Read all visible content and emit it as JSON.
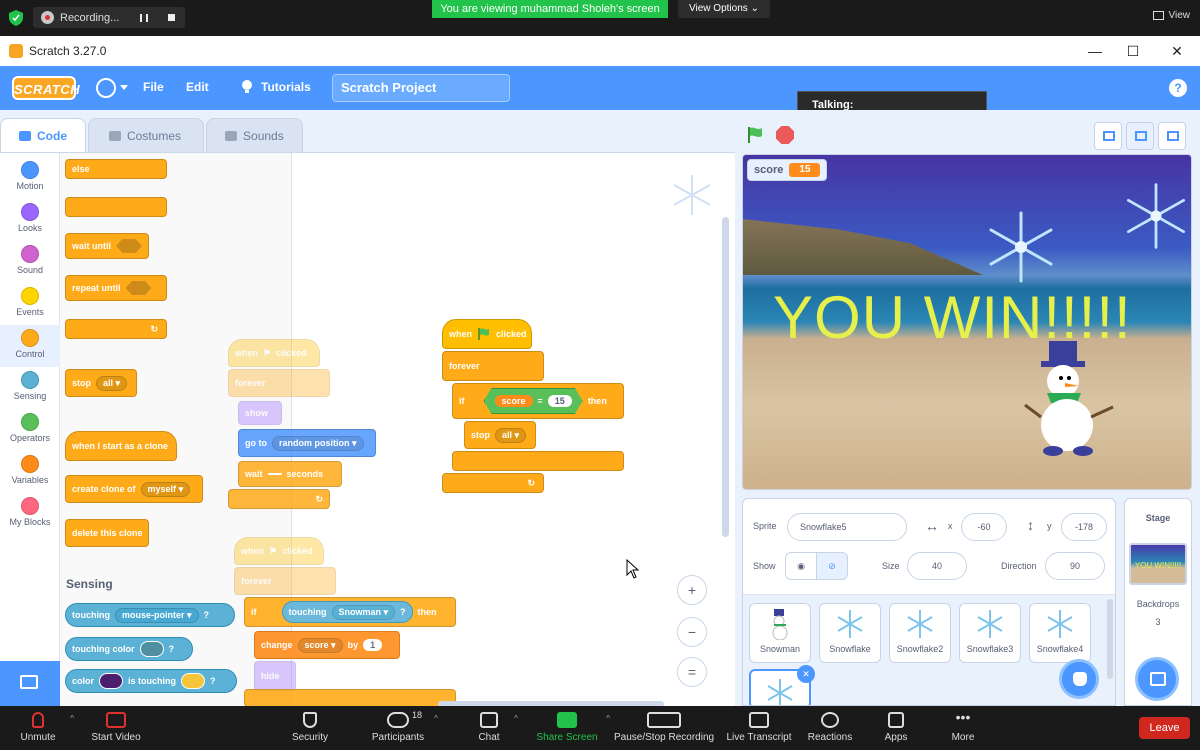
{
  "zoom_top": {
    "recording_label": "Recording...",
    "viewing_banner": "You are viewing muhammad Sholeh's screen",
    "view_options": "View Options",
    "view_label": "View"
  },
  "window": {
    "title": "Scratch 3.27.0",
    "minimize": "—",
    "maximize": "☐",
    "close": "✕"
  },
  "menubar": {
    "logo": "SCRATCH",
    "file": "File",
    "edit": "Edit",
    "tutorials": "Tutorials",
    "project_title": "Scratch Project",
    "help": "?",
    "talking": "Talking:"
  },
  "tabs": [
    "Code",
    "Costumes",
    "Sounds"
  ],
  "categories": [
    {
      "label": "Motion",
      "color": "#4c97ff"
    },
    {
      "label": "Looks",
      "color": "#9966ff"
    },
    {
      "label": "Sound",
      "color": "#cf63cf"
    },
    {
      "label": "Events",
      "color": "#ffd500"
    },
    {
      "label": "Control",
      "color": "#ffab19"
    },
    {
      "label": "Sensing",
      "color": "#5cb1d6"
    },
    {
      "label": "Operators",
      "color": "#59c059"
    },
    {
      "label": "Variables",
      "color": "#ff8c1a"
    },
    {
      "label": "My Blocks",
      "color": "#ff6680"
    }
  ],
  "palette": {
    "else": "else",
    "wait_until": "wait until",
    "repeat_until": "repeat until",
    "stop": "stop",
    "stop_option": "all",
    "when_clone": "when I start as a clone",
    "create_clone": "create clone of",
    "create_clone_option": "myself",
    "delete_clone": "delete this clone",
    "sensing_title": "Sensing",
    "touching": "touching",
    "touching_option": "mouse-pointer",
    "touching_color": "touching color",
    "color": "color",
    "is_touching": "is touching",
    "q": "?"
  },
  "script": {
    "when": "when",
    "clicked": "clicked",
    "forever": "forever",
    "if": "if",
    "score": "score",
    "equals": "=",
    "score_target": "15",
    "then": "then",
    "stop": "stop",
    "stop_option": "all"
  },
  "ghost_script": {
    "when": "when",
    "clicked": "clicked",
    "forever": "forever",
    "show": "show",
    "go_to": "go to",
    "random_position": "random position",
    "wait": "wait",
    "seconds": "seconds",
    "if": "if",
    "touching": "touching",
    "touching_option": "Snowman",
    "q": "?",
    "then": "then",
    "change": "change",
    "score": "score",
    "by": "by",
    "by_value": "1",
    "hide": "hide"
  },
  "stage": {
    "score_label": "score",
    "score_value": "15",
    "win_text": "YOU WIN!!!!!"
  },
  "sprite_info": {
    "sprite_label": "Sprite",
    "sprite_name": "Snowflake5",
    "x_label": "x",
    "x_value": "-60",
    "y_label": "y",
    "y_value": "-178",
    "show_label": "Show",
    "size_label": "Size",
    "size_value": "40",
    "direction_label": "Direction",
    "direction_value": "90"
  },
  "sprites": [
    "Snowman",
    "Snowflake",
    "Snowflake2",
    "Snowflake3",
    "Snowflake4"
  ],
  "stage_panel": {
    "title": "Stage",
    "thumb_text": "YOU WIN!!!!!",
    "backdrops_label": "Backdrops",
    "backdrops_count": "3"
  },
  "zoom_bottom": {
    "unmute": "Unmute",
    "start_video": "Start Video",
    "security": "Security",
    "participants": "Participants",
    "participants_count": "18",
    "chat": "Chat",
    "share_screen": "Share Screen",
    "pause_stop": "Pause/Stop Recording",
    "live_transcript": "Live Transcript",
    "reactions": "Reactions",
    "apps": "Apps",
    "more": "More",
    "leave": "Leave"
  },
  "colors": {
    "scratch_blue": "#4c97ff",
    "control": "#ffab19",
    "sensing": "#5cb1d6",
    "zoom_green": "#21c34b",
    "leave_red": "#d0281f"
  }
}
